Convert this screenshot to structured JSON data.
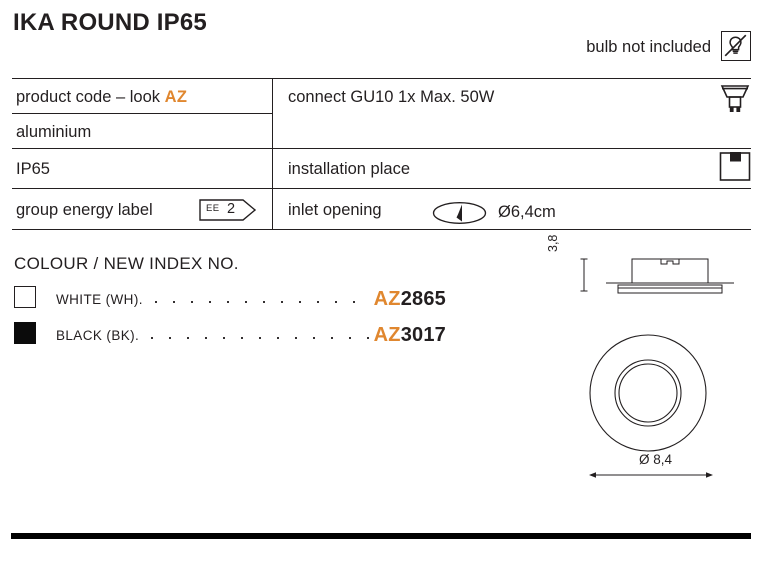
{
  "header": {
    "title": "IKA ROUND IP65",
    "bulb_note": "bulb not included",
    "bulb_icon": "bulb-crossed-out-icon"
  },
  "spec_table": {
    "rows": [
      {
        "left": "product code – look ",
        "left_accent": "AZ",
        "right": "connect GU10 1x Max. 50W",
        "icon": "gu10-lamp-icon"
      },
      {
        "left": "aluminium",
        "right": "",
        "icon": ""
      },
      {
        "left": "IP65",
        "right": "installation place",
        "icon": "recessed-ceiling-install-icon"
      },
      {
        "left": "group energy label",
        "left_badge": {
          "prefix": "EE",
          "value": "2"
        },
        "right": "inlet opening",
        "right_icon": "hole-cut-ellipse-icon",
        "right_value": "Ø6,4cm"
      }
    ]
  },
  "colour_section": {
    "heading": "COLOUR / NEW INDEX NO.",
    "items": [
      {
        "swatch": "#ffffff",
        "swatch_name": "white-colour-swatch",
        "label": "WHITE (WH).",
        "code_prefix": "AZ",
        "code_number": "2865"
      },
      {
        "swatch": "#000000",
        "swatch_name": "black-colour-swatch",
        "label": "BLACK (BK).",
        "code_prefix": "AZ",
        "code_number": "3017"
      }
    ]
  },
  "drawings": {
    "side_view": {
      "name": "side-view-drawing",
      "height_dim": "3,8"
    },
    "top_view": {
      "name": "top-view-drawing",
      "diameter_dim": "Ø 8,4"
    }
  },
  "colors": {
    "accent_orange": "#e0872f",
    "ink": "#231f20"
  }
}
